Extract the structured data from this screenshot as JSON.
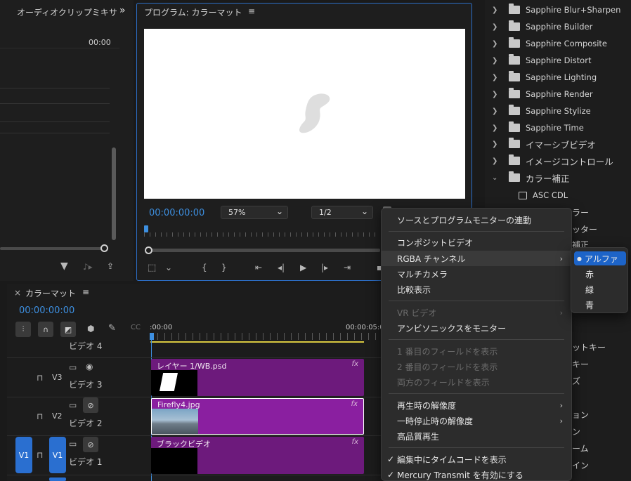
{
  "audio_mixer": {
    "title": "オーディオクリップミキサ",
    "expand": "»",
    "time": "00:00"
  },
  "program_monitor": {
    "title": "プログラム: カラーマット",
    "menu_icon": "≡",
    "timecode": "00:00:00:00",
    "zoom": "57%",
    "resolution": "1/2"
  },
  "effects_tree": {
    "items": [
      {
        "label": "Sapphire Blur+Sharpen",
        "type": "folder"
      },
      {
        "label": "Sapphire Builder",
        "type": "folder"
      },
      {
        "label": "Sapphire Composite",
        "type": "folder"
      },
      {
        "label": "Sapphire Distort",
        "type": "folder"
      },
      {
        "label": "Sapphire Lighting",
        "type": "folder"
      },
      {
        "label": "Sapphire Render",
        "type": "folder"
      },
      {
        "label": "Sapphire Stylize",
        "type": "folder"
      },
      {
        "label": "Sapphire Time",
        "type": "folder"
      },
      {
        "label": "イマーシブビデオ",
        "type": "folder"
      },
      {
        "label": "イメージコントロール",
        "type": "folder"
      },
      {
        "label": "カラー補正",
        "type": "folder-open"
      },
      {
        "label": "ASC CDL",
        "type": "effect"
      }
    ],
    "partial": [
      "ラー",
      "ッター",
      "補正"
    ],
    "partial_lower": [
      "ットキー",
      "キー",
      "ズ",
      "ョン",
      "ン",
      "ーム",
      "イン"
    ]
  },
  "timeline": {
    "title": "カラーマット",
    "menu_icon": "≡",
    "close": "×",
    "timecode": "00:00:00:00",
    "ruler_start": ":00:00",
    "ruler_end": "00:00:05:0",
    "tracks": [
      {
        "name": "ビデオ 4"
      },
      {
        "name": "ビデオ 3",
        "id": "V3"
      },
      {
        "name": "ビデオ 2",
        "id": "V2"
      },
      {
        "name": "ビデオ 1",
        "id": "V1",
        "source": "V1"
      }
    ],
    "clips": [
      {
        "name": "レイヤー 1/WB.psd",
        "fx": "fx"
      },
      {
        "name": "Firefly4.jpg",
        "fx": "fx"
      },
      {
        "name": "ブラックビデオ",
        "fx": "fx"
      }
    ]
  },
  "context_menu": {
    "items": [
      {
        "label": "ソースとプログラムモニターの連動"
      },
      {
        "label": "コンポジットビデオ"
      },
      {
        "label": "RGBA チャンネル",
        "arrow": "›"
      },
      {
        "label": "マルチカメラ"
      },
      {
        "label": "比較表示"
      },
      {
        "label": "VR ビデオ",
        "arrow": "›"
      },
      {
        "label": "アンビソニックスをモニター"
      },
      {
        "label": "1 番目のフィールドを表示"
      },
      {
        "label": "2 番目のフィールドを表示"
      },
      {
        "label": "両方のフィールドを表示"
      },
      {
        "label": "再生時の解像度",
        "arrow": "›"
      },
      {
        "label": "一時停止時の解像度",
        "arrow": "›"
      },
      {
        "label": "高品質再生"
      },
      {
        "label": "編集中にタイムコードを表示",
        "check": "✓"
      },
      {
        "label": "Mercury Transmit を有効にする",
        "check": "✓"
      }
    ]
  },
  "rgba_submenu": {
    "items": [
      {
        "label": "アルファ",
        "bullet": "●"
      },
      {
        "label": "赤"
      },
      {
        "label": "緑"
      },
      {
        "label": "青"
      }
    ]
  },
  "colors": {
    "accent": "#3d8fe0",
    "clip": "#7a1f8a",
    "menu_highlight": "#1d64c8"
  }
}
